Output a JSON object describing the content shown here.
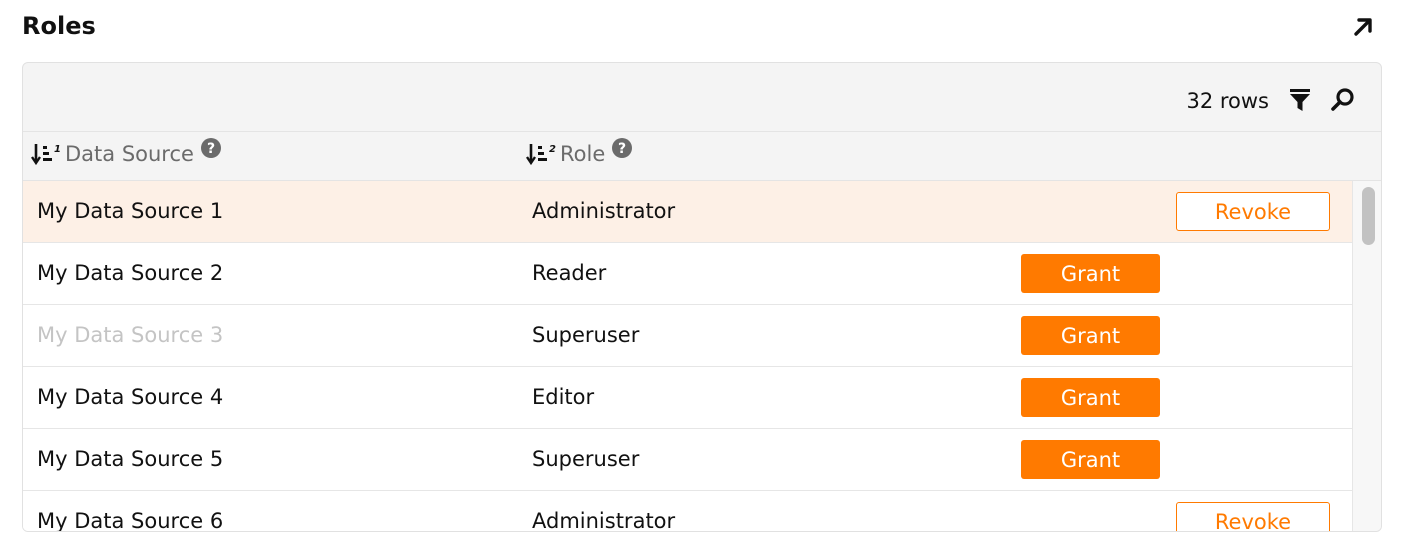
{
  "title": "Roles",
  "toolbar": {
    "row_count": "32 rows"
  },
  "columns": [
    {
      "label": "Data Source",
      "sort_order": "1"
    },
    {
      "label": "Role",
      "sort_order": "2"
    }
  ],
  "rows": [
    {
      "data_source": "My Data Source 1",
      "role": "Administrator",
      "action": "Revoke"
    },
    {
      "data_source": "My Data Source 2",
      "role": "Reader",
      "action": "Grant"
    },
    {
      "data_source": "My Data Source 3",
      "role": "Superuser",
      "action": "Grant"
    },
    {
      "data_source": "My Data Source 4",
      "role": "Editor",
      "action": "Grant"
    },
    {
      "data_source": "My Data Source 5",
      "role": "Superuser",
      "action": "Grant"
    },
    {
      "data_source": "My Data Source 6",
      "role": "Administrator",
      "action": "Revoke"
    }
  ],
  "colors": {
    "accent": "#ff7a00",
    "selected_row": "#fdf0e6",
    "muted_text": "#c4c4c4"
  },
  "icons": {
    "expand": "arrow-up-right-icon",
    "filter": "filter-icon",
    "search": "search-icon",
    "sort": "sort-desc-icon",
    "help": "help-circle-icon"
  }
}
